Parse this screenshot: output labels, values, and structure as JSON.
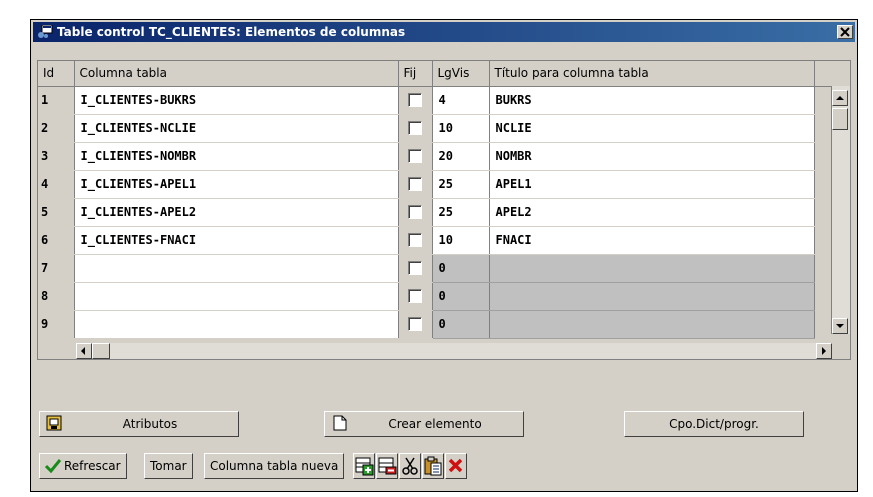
{
  "window": {
    "title": "Table control TC_CLIENTES: Elementos de columnas"
  },
  "table": {
    "headers": {
      "id": "Id",
      "columna": "Columna tabla",
      "fij": "Fij",
      "lgvis": "LgVis",
      "titulo": "Título para columna tabla"
    },
    "rows": [
      {
        "id": "1",
        "columna": "I_CLIENTES-BUKRS",
        "fij": false,
        "lgvis": "4",
        "titulo": "BUKRS"
      },
      {
        "id": "2",
        "columna": "I_CLIENTES-NCLIE",
        "fij": false,
        "lgvis": "10",
        "titulo": "NCLIE"
      },
      {
        "id": "3",
        "columna": "I_CLIENTES-NOMBR",
        "fij": false,
        "lgvis": "20",
        "titulo": "NOMBR"
      },
      {
        "id": "4",
        "columna": "I_CLIENTES-APEL1",
        "fij": false,
        "lgvis": "25",
        "titulo": "APEL1"
      },
      {
        "id": "5",
        "columna": "I_CLIENTES-APEL2",
        "fij": false,
        "lgvis": "25",
        "titulo": "APEL2"
      },
      {
        "id": "6",
        "columna": "I_CLIENTES-FNACI",
        "fij": false,
        "lgvis": "10",
        "titulo": "FNACI"
      },
      {
        "id": "7",
        "columna": "",
        "fij": false,
        "lgvis": "0",
        "titulo": ""
      },
      {
        "id": "8",
        "columna": "",
        "fij": false,
        "lgvis": "0",
        "titulo": ""
      },
      {
        "id": "9",
        "columna": "",
        "fij": false,
        "lgvis": "0",
        "titulo": ""
      }
    ]
  },
  "buttons": {
    "atributos": "Atributos",
    "crear_elemento": "Crear elemento",
    "cpo_dict": "Cpo.Dict/progr."
  },
  "toolbar": {
    "refrescar": "Refrescar",
    "tomar": "Tomar",
    "columna_nueva": "Columna tabla nueva"
  },
  "icons": [
    "sap-window-icon",
    "close-icon",
    "attributes-icon",
    "new-document-icon",
    "checkmark-icon",
    "insert-row-icon",
    "delete-row-icon",
    "cut-icon",
    "paste-icon",
    "delete-icon"
  ]
}
